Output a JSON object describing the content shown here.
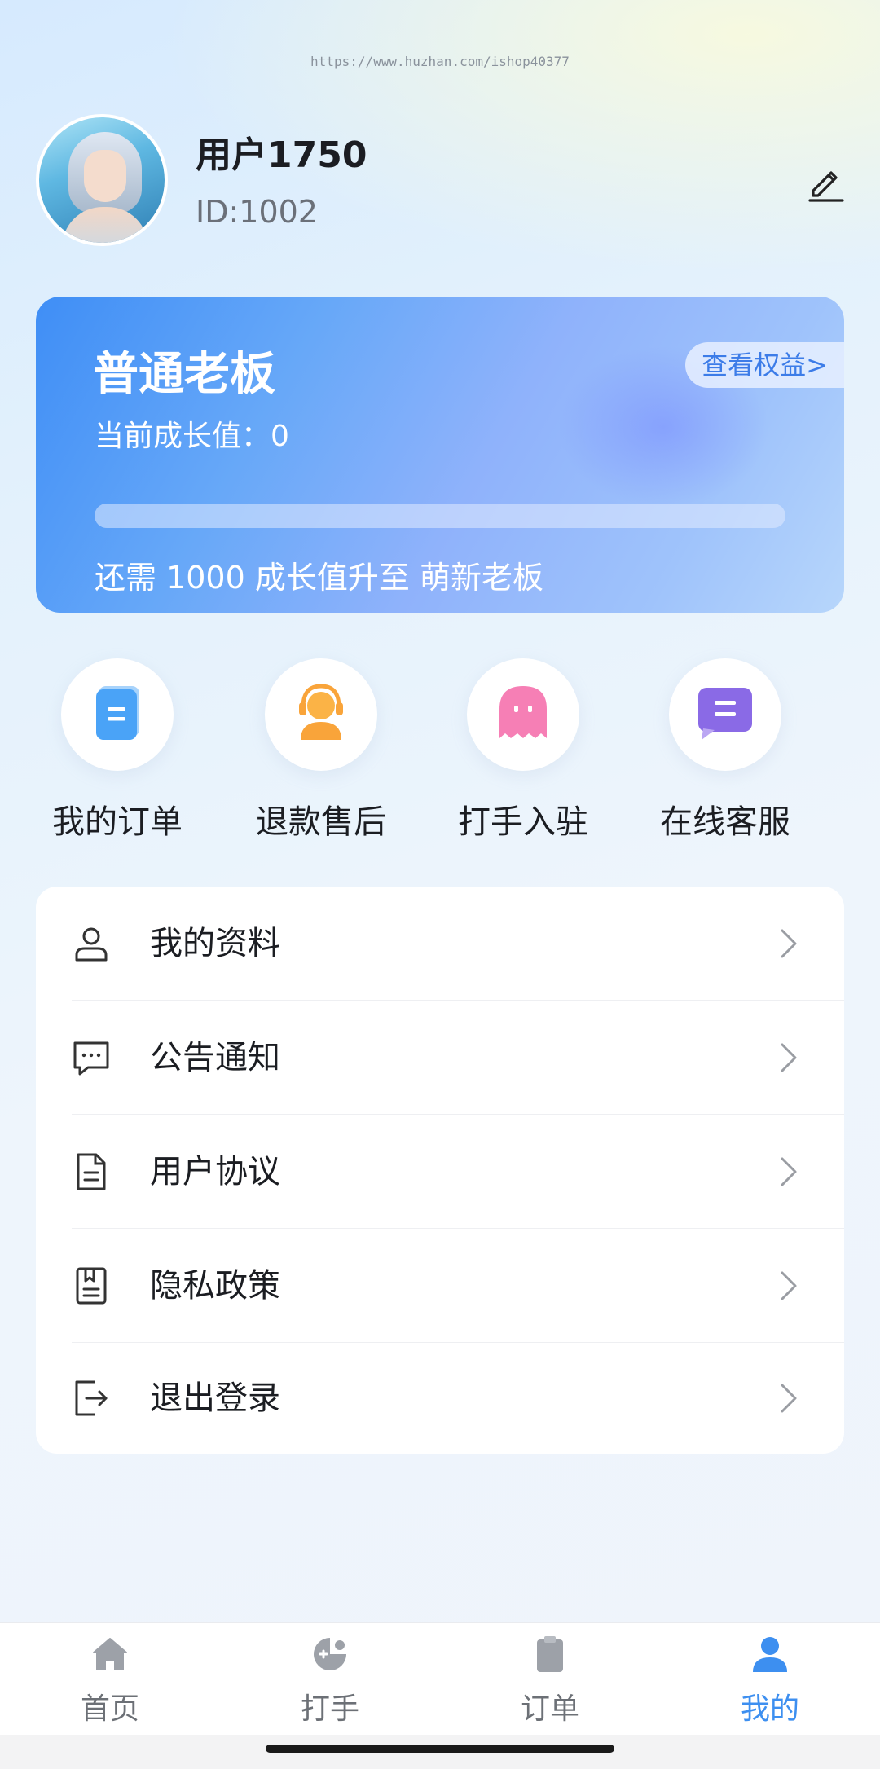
{
  "watermark": "https://www.huzhan.com/ishop40377",
  "profile": {
    "username": "用户1750",
    "user_id": "ID:1002"
  },
  "level_card": {
    "level_name": "普通老板",
    "growth_text": "当前成长值：0",
    "benefits_button": "查看权益>",
    "progress": 0,
    "upgrade_text": "还需 1000 成长值升至 萌新老板"
  },
  "quick_actions": [
    {
      "label": "我的订单",
      "icon": "order-icon",
      "color": "#4aa3f7"
    },
    {
      "label": "退款售后",
      "icon": "headset-icon",
      "color": "#f9a43a"
    },
    {
      "label": "打手入驻",
      "icon": "ghost-icon",
      "color": "#f67fb5"
    },
    {
      "label": "在线客服",
      "icon": "chat-icon",
      "color": "#8a6ae6"
    }
  ],
  "menu": [
    {
      "label": "我的资料",
      "icon": "user-icon"
    },
    {
      "label": "公告通知",
      "icon": "message-icon"
    },
    {
      "label": "用户协议",
      "icon": "document-icon"
    },
    {
      "label": "隐私政策",
      "icon": "policy-icon"
    },
    {
      "label": "退出登录",
      "icon": "logout-icon"
    }
  ],
  "tabbar": [
    {
      "label": "首页",
      "icon": "home-icon",
      "active": false
    },
    {
      "label": "打手",
      "icon": "gamepad-icon",
      "active": false
    },
    {
      "label": "订单",
      "icon": "clipboard-icon",
      "active": false
    },
    {
      "label": "我的",
      "icon": "person-icon",
      "active": true
    }
  ],
  "colors": {
    "accent": "#3d8ff0",
    "card_start": "#3f8ef6",
    "card_end": "#b7d6fb"
  }
}
